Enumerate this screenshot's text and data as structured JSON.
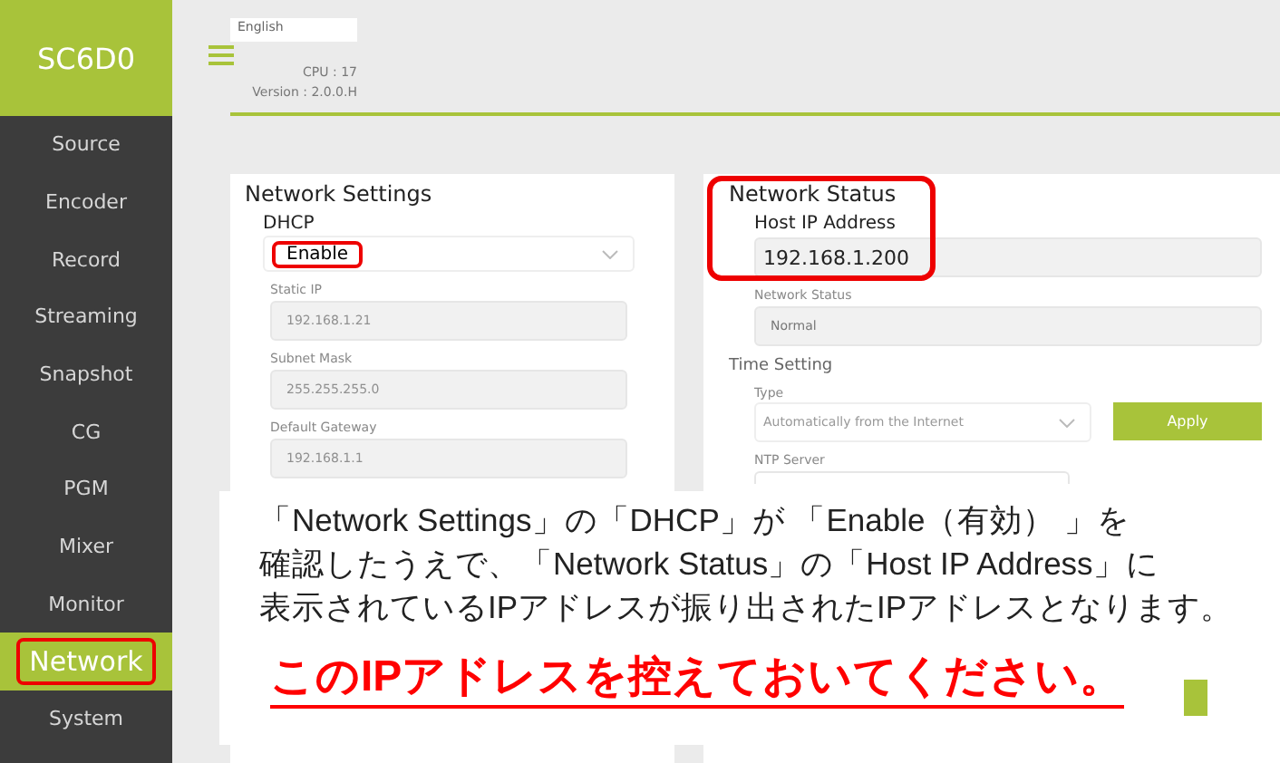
{
  "sidebar": {
    "logo": "SC6D0",
    "items": [
      {
        "label": "Source",
        "selected": false
      },
      {
        "label": "Encoder",
        "selected": false
      },
      {
        "label": "Record",
        "selected": false
      },
      {
        "label": "Streaming",
        "selected": false
      },
      {
        "label": "Snapshot",
        "selected": false
      },
      {
        "label": "CG",
        "selected": false
      },
      {
        "label": "PGM",
        "selected": false
      },
      {
        "label": "Mixer",
        "selected": false
      },
      {
        "label": "Monitor",
        "selected": false
      },
      {
        "label": "Network",
        "selected": true,
        "highlighted": true
      },
      {
        "label": "System",
        "selected": false
      }
    ]
  },
  "header": {
    "language": "English",
    "cpu": "CPU : 17",
    "version": "Version : 2.0.0.H"
  },
  "network_settings": {
    "title": "Network Settings",
    "dhcp_label": "DHCP",
    "dhcp_value": "Enable",
    "dhcp_highlighted": true,
    "fields": [
      {
        "label": "Static IP",
        "value": "192.168.1.21",
        "disabled": true
      },
      {
        "label": "Subnet Mask",
        "value": "255.255.255.0",
        "disabled": true
      },
      {
        "label": "Default Gateway",
        "value": "192.168.1.1",
        "disabled": true
      }
    ]
  },
  "network_status": {
    "title": "Network Status",
    "highlighted": true,
    "fields": [
      {
        "label": "Host IP Address",
        "value": "192.168.1.200",
        "emphasized": true
      },
      {
        "label": "Network Status",
        "value": "Normal",
        "emphasized": false
      }
    ]
  },
  "time_setting": {
    "title": "Time Setting",
    "type_label": "Type",
    "type_value": "Automatically from the Internet",
    "apply": "Apply",
    "ntp_label": "NTP Server"
  },
  "annotation": {
    "lines": [
      "「Network Settings」の「DHCP」が 「Enable（有効） 」を",
      "確認したうえで、「Network Status」の「Host IP Address」に",
      "表示されているIPアドレスが振り出されたIPアドレスとなります。"
    ],
    "emphasis": "このIPアドレスを控えておいてください。"
  }
}
